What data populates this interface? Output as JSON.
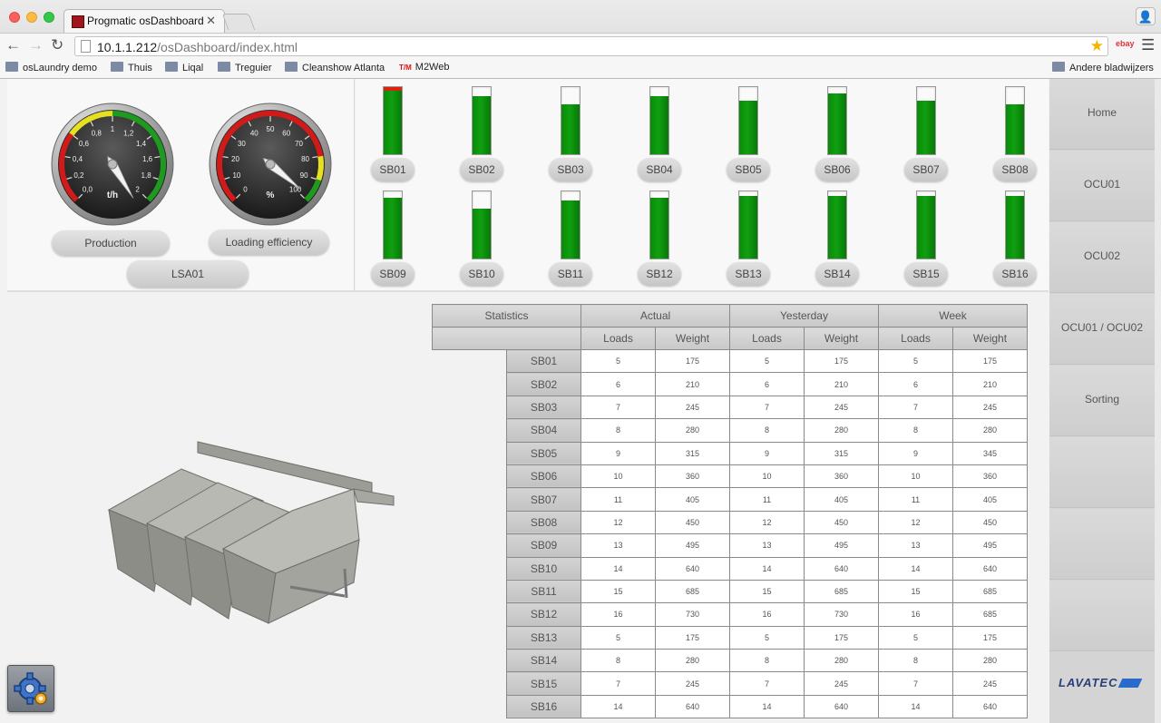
{
  "browser": {
    "tab_title": "Progmatic osDashboard",
    "url_host": "10.1.1.212",
    "url_path": "/osDashboard/index.html",
    "bookmarks": [
      {
        "label": "osLaundry demo",
        "icon": "folder-icon"
      },
      {
        "label": "Thuis",
        "icon": "folder-icon"
      },
      {
        "label": "Liqal",
        "icon": "folder-icon"
      },
      {
        "label": "Treguier",
        "icon": "folder-icon"
      },
      {
        "label": "Cleanshow Atlanta",
        "icon": "folder-icon"
      },
      {
        "label": "M2Web",
        "icon": "tvm-icon",
        "badge": "T/M"
      }
    ],
    "other_bookmarks": "Andere bladwijzers",
    "extension_badge": "ebay"
  },
  "gauges": {
    "production": {
      "label": "Production",
      "unit": "t/h",
      "ticks": [
        "0,0",
        "0,2",
        "0,4",
        "0,6",
        "0,8",
        "1",
        "1,2",
        "1,4",
        "1,6",
        "1,8",
        "2"
      ],
      "min": 0,
      "max": 2,
      "value": 2.1
    },
    "loading": {
      "label": "Loading efficiency",
      "unit": "%",
      "ticks": [
        "0",
        "10",
        "20",
        "30",
        "40",
        "50",
        "60",
        "70",
        "80",
        "90",
        "100"
      ],
      "min": 0,
      "max": 100,
      "value": 98
    },
    "line_label": "LSA01"
  },
  "bins": [
    {
      "label": "SB01",
      "level": 0.97,
      "alert": true
    },
    {
      "label": "SB02",
      "level": 0.86
    },
    {
      "label": "SB03",
      "level": 0.74
    },
    {
      "label": "SB04",
      "level": 0.86
    },
    {
      "label": "SB05",
      "level": 0.8
    },
    {
      "label": "SB06",
      "level": 0.9
    },
    {
      "label": "SB07",
      "level": 0.8
    },
    {
      "label": "SB08",
      "level": 0.74
    },
    {
      "label": "SB09",
      "level": 0.9
    },
    {
      "label": "SB10",
      "level": 0.74
    },
    {
      "label": "SB11",
      "level": 0.86
    },
    {
      "label": "SB12",
      "level": 0.9
    },
    {
      "label": "SB13",
      "level": 0.93
    },
    {
      "label": "SB14",
      "level": 0.93
    },
    {
      "label": "SB15",
      "level": 0.93
    },
    {
      "label": "SB16",
      "level": 0.93
    }
  ],
  "nav": {
    "items": [
      "Home",
      "OCU01",
      "OCU02",
      "OCU01 / OCU02",
      "Sorting"
    ],
    "logo": "LAVATEC"
  },
  "stats": {
    "title": "Statistics",
    "groups": [
      "Actual",
      "Yesterday",
      "Week"
    ],
    "subheaders": [
      "Loads",
      "Weight",
      "Loads",
      "Weight",
      "Loads",
      "Weight"
    ],
    "rows": [
      {
        "name": "SB01",
        "values": [
          "5",
          "175",
          "5",
          "175",
          "5",
          "175"
        ]
      },
      {
        "name": "SB02",
        "values": [
          "6",
          "210",
          "6",
          "210",
          "6",
          "210"
        ]
      },
      {
        "name": "SB03",
        "values": [
          "7",
          "245",
          "7",
          "245",
          "7",
          "245"
        ]
      },
      {
        "name": "SB04",
        "values": [
          "8",
          "280",
          "8",
          "280",
          "8",
          "280"
        ]
      },
      {
        "name": "SB05",
        "values": [
          "9",
          "315",
          "9",
          "315",
          "9",
          "345"
        ]
      },
      {
        "name": "SB06",
        "values": [
          "10",
          "360",
          "10",
          "360",
          "10",
          "360"
        ]
      },
      {
        "name": "SB07",
        "values": [
          "11",
          "405",
          "11",
          "405",
          "11",
          "405"
        ]
      },
      {
        "name": "SB08",
        "values": [
          "12",
          "450",
          "12",
          "450",
          "12",
          "450"
        ]
      },
      {
        "name": "SB09",
        "values": [
          "13",
          "495",
          "13",
          "495",
          "13",
          "495"
        ]
      },
      {
        "name": "SB10",
        "values": [
          "14",
          "640",
          "14",
          "640",
          "14",
          "640"
        ]
      },
      {
        "name": "SB11",
        "values": [
          "15",
          "685",
          "15",
          "685",
          "15",
          "685"
        ]
      },
      {
        "name": "SB12",
        "values": [
          "16",
          "730",
          "16",
          "730",
          "16",
          "685"
        ]
      },
      {
        "name": "SB13",
        "values": [
          "5",
          "175",
          "5",
          "175",
          "5",
          "175"
        ]
      },
      {
        "name": "SB14",
        "values": [
          "8",
          "280",
          "8",
          "280",
          "8",
          "280"
        ]
      },
      {
        "name": "SB15",
        "values": [
          "7",
          "245",
          "7",
          "245",
          "7",
          "245"
        ]
      },
      {
        "name": "SB16",
        "values": [
          "14",
          "640",
          "14",
          "640",
          "14",
          "640"
        ]
      }
    ]
  }
}
